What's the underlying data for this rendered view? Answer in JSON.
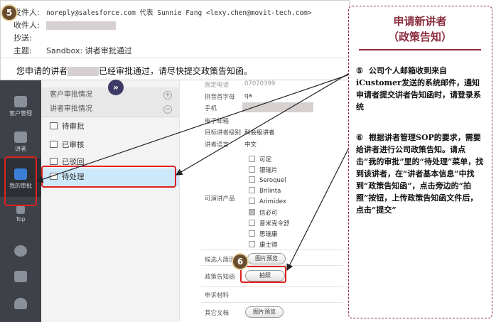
{
  "email": {
    "step": "5",
    "from_label": "发件人:",
    "from_value": "noreply@salesforce.com 代表 Sunnie Fang <lexy.chen@movit-tech.com>",
    "to_label": "收件人:",
    "cc_label": "抄送:",
    "subject_label": "主题:",
    "subject_value": "Sandbox: 讲者审批通过",
    "body_pre": "您申请的讲者",
    "body_post": "已经审批通过，请尽快提交政策告知函。"
  },
  "sidebar": {
    "items": [
      {
        "label": "客户管理",
        "icon": "people-icon"
      },
      {
        "label": "讲者",
        "icon": "graduation-cap-icon"
      },
      {
        "label": "我的审批",
        "icon": "document-icon"
      },
      {
        "label": "Top",
        "icon": "network-icon"
      },
      {
        "label": "",
        "icon": "refresh-icon"
      },
      {
        "label": "",
        "icon": "search-window-icon"
      },
      {
        "label": "",
        "icon": "user-icon"
      }
    ]
  },
  "tree": {
    "group1": "客户审批情况",
    "group2": "讲者审批情况",
    "items": [
      "待审批",
      "已审核",
      "已驳回",
      "待处理"
    ]
  },
  "form": {
    "top_label": "固定电话",
    "top_value": "07070399",
    "pinyin_label": "拼音首字母",
    "pinyin_value": "qa",
    "mobile_label": "手机",
    "email_label": "电子邮箱",
    "level_label": "目标讲者级别",
    "level_value": "科会级讲者",
    "lang_label": "讲者语言",
    "lang_value": "中文",
    "products_label": "可演讲产品",
    "products": [
      {
        "name": "可定",
        "checked": false
      },
      {
        "name": "银瑞片",
        "checked": false
      },
      {
        "name": "Seroquel",
        "checked": false
      },
      {
        "name": "Brilinta",
        "checked": false
      },
      {
        "name": "Arimidex",
        "checked": false
      },
      {
        "name": "信必可",
        "checked": true
      },
      {
        "name": "普米克令舒",
        "checked": false
      },
      {
        "name": "思瑞康",
        "checked": false
      },
      {
        "name": "康士得",
        "checked": false
      }
    ],
    "resume_label": "候选人简历",
    "resume_btn": "图片预览",
    "step": "6",
    "policy_label": "政策告知函",
    "photo_btn": "拍照",
    "appeal_label": "申诉材料",
    "other_label": "其它文档",
    "other_btn": "图片预览"
  },
  "panel": {
    "title1": "申请新讲者",
    "title2": "（政策告知）",
    "p5_num": "⑤",
    "p5_text": "公司个人邮箱收到来自iCustomer发送的系统邮件，通知申请者提交讲者告知函时，请登录系统",
    "p6_num": "⑥",
    "p6_text": "根据讲者管理SOP的要求，需要给讲者进行公司政策告知。请点击“我的审批”里的“待处理”菜单，找到该讲者，在“讲者基本信息”中找到“政策告知函”，点击旁边的“拍照”按钮，上传政策告知函文件后，点击“提交”"
  }
}
